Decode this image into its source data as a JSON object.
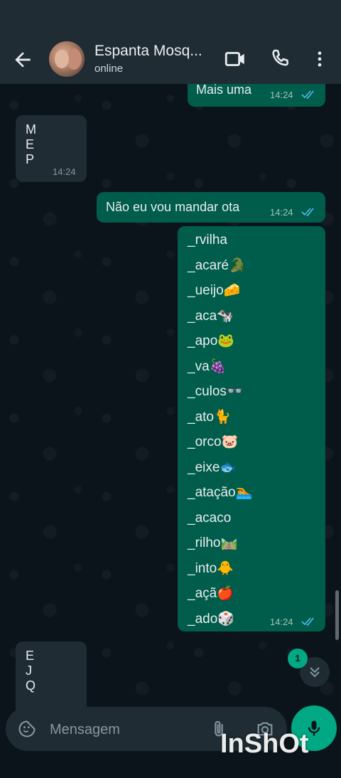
{
  "header": {
    "contact_name": "Espanta Mosq...",
    "status": "online",
    "icons": [
      "back-arrow-icon",
      "video-call-icon",
      "voice-call-icon",
      "more-vertical-icon"
    ]
  },
  "messages": [
    {
      "dir": "out",
      "text": "Mais uma",
      "time": "14:24",
      "status": "read"
    },
    {
      "dir": "in",
      "lines": [
        "M",
        "E",
        "P"
      ],
      "time": "14:24"
    },
    {
      "dir": "out",
      "text": "Não eu vou mandar ota",
      "time": "14:24",
      "status": "read"
    },
    {
      "dir": "out",
      "lines": [
        "_rvilha",
        "_acaré🐊",
        "_ueijo🧀",
        "_aca🐄",
        "_apo🐸",
        "_va🍇",
        "_culos👓",
        "_ato🐈",
        "_orco🐷",
        "_eixe🐟",
        "_atação🏊",
        "_acaco",
        "_rilho🛤️",
        "_into🐥",
        "_açã🍎",
        "_ado🎲"
      ],
      "time": "14:24",
      "status": "read"
    },
    {
      "dir": "in",
      "lines": [
        "E",
        "J",
        "Q"
      ]
    }
  ],
  "scroll_down": {
    "unread_count": "1"
  },
  "composer": {
    "placeholder": "Mensagem"
  },
  "watermark": "InShOt",
  "colors": {
    "background": "#0b141a",
    "header": "#1f2c34",
    "outgoing_bubble": "#005c4b",
    "incoming_bubble": "#1f2c34",
    "accent": "#00a884",
    "read_ticks": "#53bdeb"
  }
}
